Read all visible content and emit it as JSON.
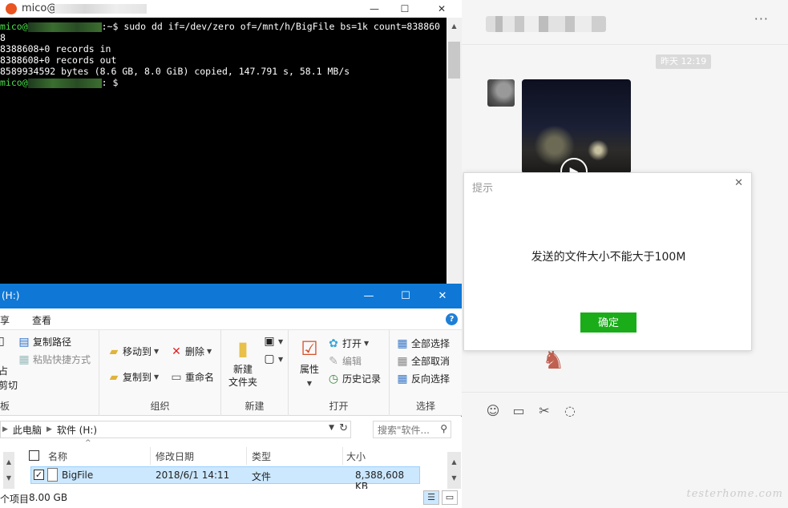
{
  "terminal": {
    "title": "mico@",
    "prompt_user": "mico@",
    "prompt_tail": ":~$",
    "prompt_tail2": ": $",
    "command": " sudo dd if=/dev/zero of=/mnt/h/BigFile bs=1k count=838860",
    "command_wrap": "8",
    "out1": "8388608+0 records in",
    "out2": "8388608+0 records out",
    "out3": "8589934592 bytes (8.6 GB, 8.0 GiB) copied, 147.791 s, 58.1 MB/s",
    "colors": {
      "prompt": "#4be04b",
      "bg": "#000000",
      "icon": "#e95420"
    }
  },
  "explorer": {
    "title": "(H:)",
    "menu": {
      "share": "享",
      "view": "查看"
    },
    "ribbon": {
      "clipboard": {
        "copy_path": "复制路径",
        "paste_shortcut": "粘贴快捷方式",
        "paste_frag": "占",
        "cut_frag": "剪切",
        "label": "板"
      },
      "organize": {
        "move_to": "移动到",
        "delete": "删除",
        "copy_to": "复制到",
        "rename": "重命名",
        "label": "组织"
      },
      "new": {
        "new_folder_line1": "新建",
        "new_folder_line2": "文件夹",
        "label": "新建"
      },
      "open": {
        "properties": "属性",
        "open": "打开",
        "edit": "编辑",
        "history": "历史记录",
        "label": "打开"
      },
      "select": {
        "select_all": "全部选择",
        "select_none": "全部取消",
        "invert": "反向选择",
        "label": "选择"
      }
    },
    "address": {
      "crumbs": [
        "此电脑",
        "软件 (H:)"
      ],
      "search_placeholder": "搜索\"软件..."
    },
    "columns": [
      "名称",
      "修改日期",
      "类型",
      "大小"
    ],
    "files": [
      {
        "name": "BigFile",
        "modified": "2018/6/1 14:11",
        "type": "文件",
        "size": "8,388,608 KB"
      }
    ],
    "status": {
      "count": "个项目",
      "size": "8.00 GB"
    },
    "colors": {
      "titlebar": "#0f78d6",
      "selected_row": "#cce8ff"
    }
  },
  "chat": {
    "timestamp": "昨天 12:19",
    "dialog": {
      "title": "提示",
      "message": "发送的文件大小不能大于100M",
      "ok": "确定"
    },
    "colors": {
      "ok_button": "#1aad19"
    },
    "watermark": "testerhome.com"
  }
}
